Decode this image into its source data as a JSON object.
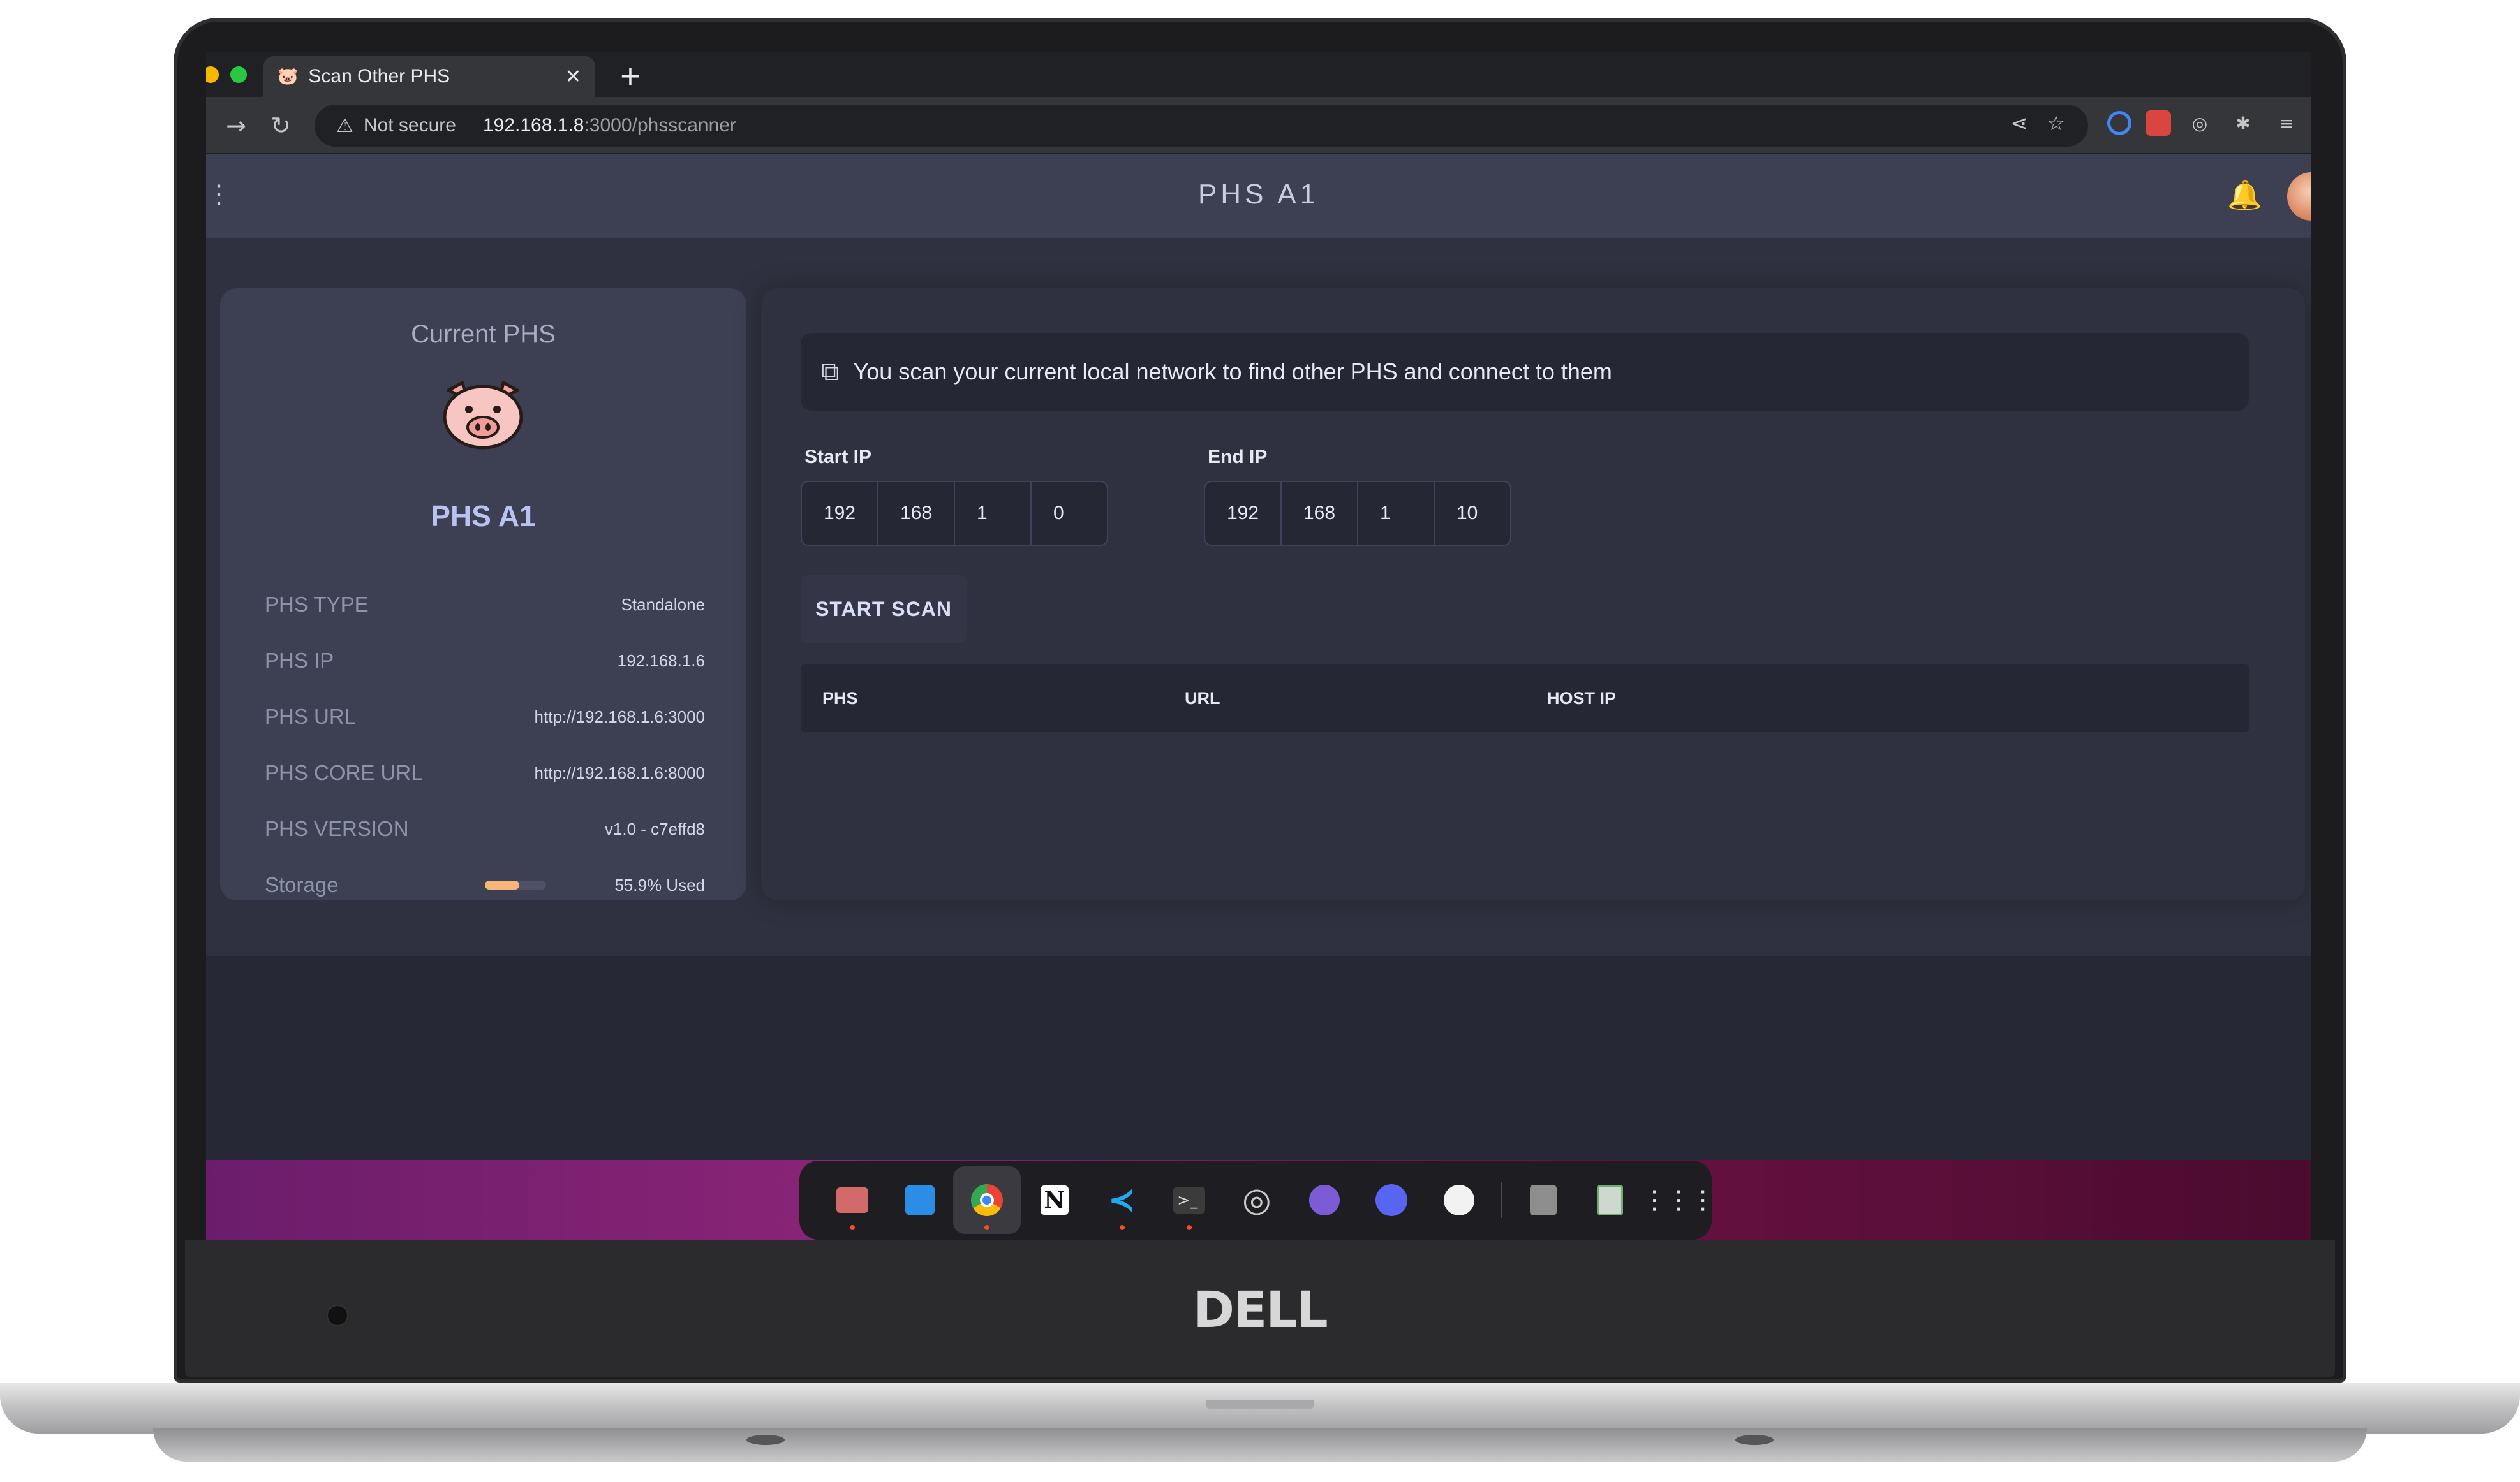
{
  "browser": {
    "tab_title": "Scan Other PHS",
    "tab_close": "✕",
    "new_tab": "+",
    "security_label": "Not secure",
    "url_host": "192.168.1.8",
    "url_path": ":3000/phsscanner"
  },
  "app": {
    "title": "PHS A1"
  },
  "current_phs": {
    "heading": "Current PHS",
    "name": "PHS A1",
    "rows": [
      {
        "label": "PHS TYPE",
        "value": "Standalone"
      },
      {
        "label": "PHS IP",
        "value": "192.168.1.6"
      },
      {
        "label": "PHS URL",
        "value": "http://192.168.1.6:3000"
      },
      {
        "label": "PHS CORE URL",
        "value": "http://192.168.1.6:8000"
      },
      {
        "label": "PHS VERSION",
        "value": "v1.0 - c7effd8"
      }
    ],
    "storage_label": "Storage",
    "storage_value": "55.9% Used",
    "storage_fraction": 0.559
  },
  "scanner": {
    "info_text": "You scan your current local network to find other PHS and connect to them",
    "start_ip_label": "Start IP",
    "start_ip": [
      "192",
      "168",
      "1",
      "0"
    ],
    "end_ip_label": "End IP",
    "end_ip": [
      "192",
      "168",
      "1",
      "10"
    ],
    "start_button": "START SCAN",
    "columns": [
      "PHS",
      "URL",
      "HOST IP"
    ]
  },
  "device": {
    "brand": "DELL"
  },
  "colors": {
    "accent": "#b8c3f2",
    "storage_bar": "#f5b678",
    "header": "#3d3f52",
    "background": "#2f3140"
  },
  "dock": [
    "files-icon",
    "screenshot-icon",
    "chrome-icon",
    "notion-icon",
    "vscode-icon",
    "terminal-icon",
    "settings-icon",
    "github-icon",
    "discord-icon",
    "app-icon",
    "disk-icon",
    "trash-icon",
    "apps-grid-icon"
  ]
}
